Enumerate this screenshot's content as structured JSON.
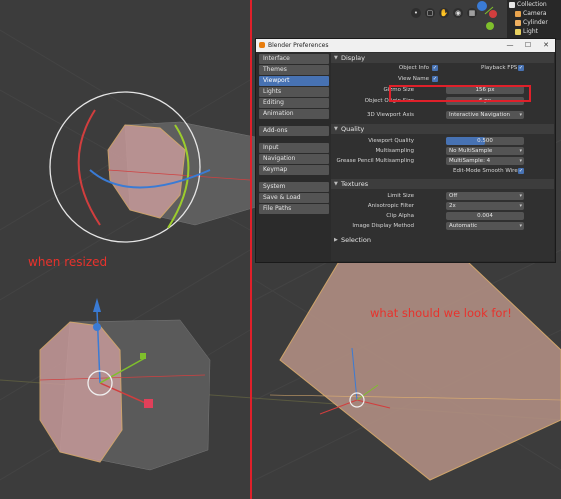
{
  "outliner": {
    "items": [
      {
        "label": "Collection",
        "icon": "collection-icon"
      },
      {
        "label": "Camera",
        "icon": "camera-icon"
      },
      {
        "label": "Cylinder",
        "icon": "mesh-icon"
      },
      {
        "label": "Light",
        "icon": "light-icon"
      }
    ]
  },
  "prefs": {
    "title": "Blender Preferences",
    "controls": {
      "minimize": "—",
      "maximize": "☐",
      "close": "✕"
    },
    "sidebar": {
      "group1": [
        "Interface",
        "Themes",
        "Viewport",
        "Lights",
        "Editing",
        "Animation"
      ],
      "group2": [
        "Add-ons"
      ],
      "group3": [
        "Input",
        "Navigation",
        "Keymap"
      ],
      "group4": [
        "System",
        "Save & Load",
        "File Paths"
      ],
      "active": "Viewport"
    },
    "display": {
      "header": "Display",
      "object_info": "Object Info",
      "playback_fps": "Playback FPS",
      "view_name": "View Name",
      "gizmo_size_label": "Gizmo Size",
      "gizmo_size_value": "156 px",
      "origin_size_label": "Object Origin Size",
      "origin_size_value": "6 px",
      "axis_label": "3D Viewport Axis",
      "axis_value": "Interactive Navigation"
    },
    "quality": {
      "header": "Quality",
      "viewport_quality_label": "Viewport Quality",
      "viewport_quality_value": "0.500",
      "viewport_quality_fraction": 0.5,
      "multisampling_label": "Multisampling",
      "multisampling_value": "No MultiSample",
      "gp_multisampling_label": "Grease Pencil Multisampling",
      "gp_multisampling_value": "MultiSample: 4",
      "edit_smooth_wires": "Edit-Mode Smooth Wires"
    },
    "textures": {
      "header": "Textures",
      "limit_size_label": "Limit Size",
      "limit_size_value": "Off",
      "anisotropic_label": "Anisotropic Filter",
      "anisotropic_value": "2x",
      "clip_alpha_label": "Clip Alpha",
      "clip_alpha_value": "0.004",
      "image_display_label": "Image Display Method",
      "image_display_value": "Automatic"
    },
    "selection": {
      "header": "Selection"
    }
  },
  "annotations": {
    "when_resized": "when resized",
    "look_for": "what should we look for!"
  },
  "colors": {
    "annotation_red": "#e8322c",
    "active_blue": "#4772b3",
    "blender_orange": "#e87d0d"
  }
}
